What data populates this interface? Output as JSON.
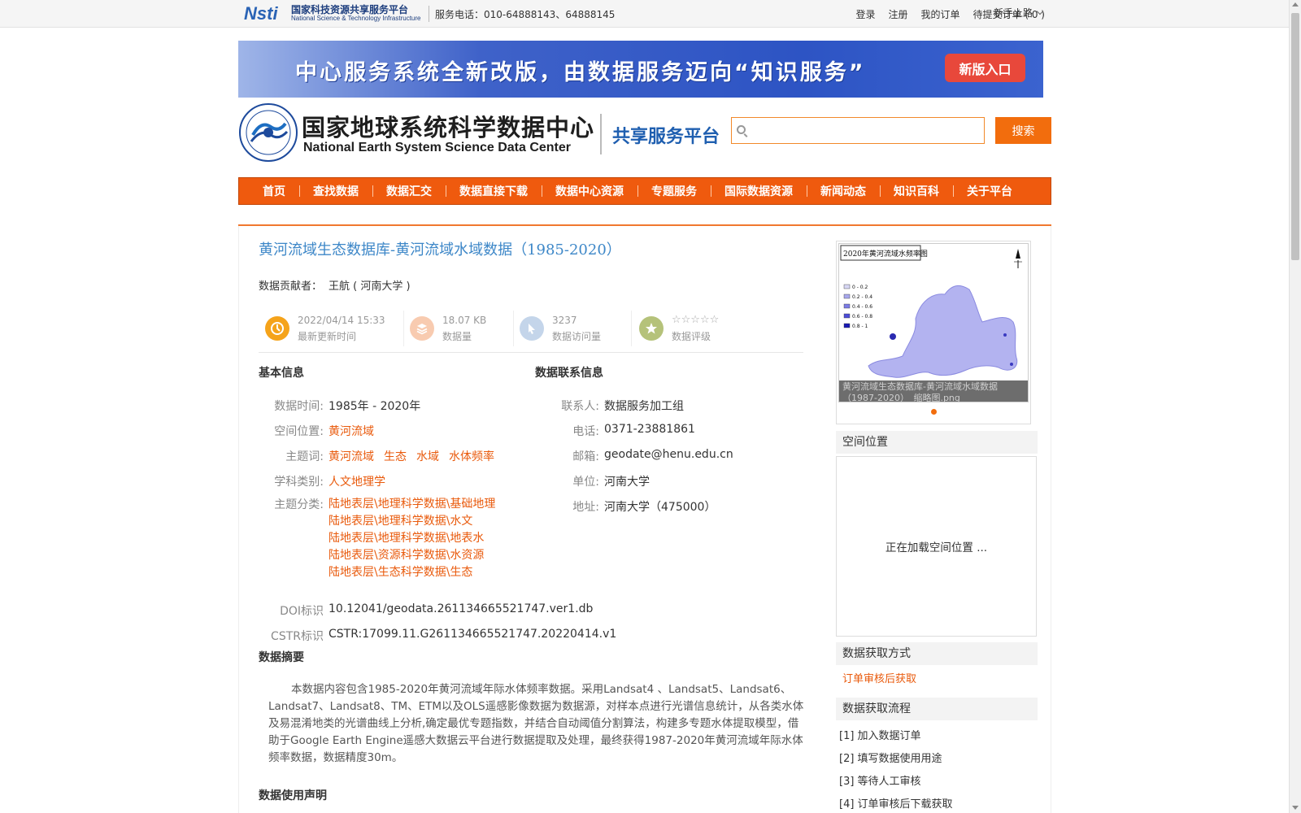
{
  "topbar": {
    "nsti_mark": "Nsti",
    "nsti_cn": "国家科技资源共享服务平台",
    "nsti_en": "National Science & Technology Infrastructure",
    "phone": "服务电话：010-64888143、64888145",
    "links": [
      "登录",
      "注册",
      "我的订单",
      "待提交订单 ( 0 )"
    ],
    "guide": "新手上路"
  },
  "banner": {
    "text": "中心服务系统全新改版，由数据服务迈向“知识服务”",
    "button": "新版入口"
  },
  "header": {
    "logo_cn": "国家地球系统科学数据中心",
    "logo_en": "National Earth System Science Data Center",
    "platform": "共享服务平台",
    "search_placeholder": "",
    "search_button": "搜索"
  },
  "nav": [
    "首页",
    "查找数据",
    "数据汇交",
    "数据直接下载",
    "数据中心资源",
    "专题服务",
    "国际数据资源",
    "新闻动态",
    "知识百科",
    "关于平台"
  ],
  "dataset": {
    "title": "黄河流域生态数据库-黄河流域水域数据（1985-2020）",
    "contributor_label": "数据贡献者：",
    "contributor": "王航 ( 河南大学 )",
    "stats": [
      {
        "value": "2022/04/14 15:33",
        "label": "最新更新时间",
        "icon": "clock-icon",
        "color": "#f5a31a"
      },
      {
        "value": "18.07 KB",
        "label": "数据量",
        "icon": "layers-icon",
        "color": "#f8cbb0"
      },
      {
        "value": "3237",
        "label": "数据访问量",
        "icon": "pointer-icon",
        "color": "#c4d5ea"
      },
      {
        "value": "☆☆☆☆☆",
        "label": "数据评级",
        "icon": "star-icon",
        "color": "#b5c27a"
      }
    ]
  },
  "basic": {
    "title": "基本信息",
    "time_label": "数据时间:",
    "time": "1985年 - 2020年",
    "space_label": "空间位置:",
    "space": "黄河流域",
    "keywords_label": "主题词:",
    "keywords": [
      "黄河流域",
      "生态",
      "水域",
      "水体频率"
    ],
    "discipline_label": "学科类别:",
    "discipline": "人文地理学",
    "category_label": "主题分类:",
    "categories": [
      "陆地表层\\地理科学数据\\基础地理",
      "陆地表层\\地理科学数据\\水文",
      "陆地表层\\地理科学数据\\地表水",
      "陆地表层\\资源科学数据\\水资源",
      "陆地表层\\生态科学数据\\生态"
    ],
    "doi_label": "DOI标识",
    "doi": "10.12041/geodata.261134665521747.ver1.db",
    "cstr_label": "CSTR标识",
    "cstr": "CSTR:17099.11.G261134665521747.20220414.v1"
  },
  "contact": {
    "title": "数据联系信息",
    "person_label": "联系人:",
    "person": "数据服务加工组",
    "phone_label": "电话:",
    "phone": "0371-23881861",
    "email_label": "邮箱:",
    "email": "geodate@henu.edu.cn",
    "unit_label": "单位:",
    "unit": "河南大学",
    "address_label": "地址:",
    "address": "河南大学（475000）"
  },
  "abstract": {
    "title": "数据摘要",
    "text": "本数据内容包含1985-2020年黄河流域年际水体频率数据。采用Landsat4 、Landsat5、Landsat6、Landsat7、Landsat8、TM、ETM以及OLS遥感影像数据为数据源，对样本点进行光谱信息统计，从各类水体及易混淆地类的光谱曲线上分析,确定最优专题指数，并结合自动阈值分割算法，构建多专题水体提取模型，借助于Google Earth Engine遥感大数据云平台进行数据提取及处理，最终获得1987-2020年黄河流域年际水体频率数据，数据精度30m。"
  },
  "usage": {
    "title": "数据使用声明"
  },
  "side": {
    "thumb_title": "2020年黄河流域水频率图",
    "thumb_legend": [
      "0 - 0.2",
      "0.2 - 0.4",
      "0.4 - 0.6",
      "0.6 - 0.8",
      "0.8 - 1"
    ],
    "thumb_legend_colors": [
      "#d8d8f5",
      "#a8a8ee",
      "#7c7ce6",
      "#4d4dd8",
      "#1a1ab5"
    ],
    "thumb_caption": "黄河流域生态数据库-黄河流域水域数据（1987-2020）_缩略图.png",
    "space_title": "空间位置",
    "map_loading": "正在加载空间位置 ...",
    "access_title": "数据获取方式",
    "access": "订单审核后获取",
    "flow_title": "数据获取流程",
    "flow": [
      "[1] 加入数据订单",
      "[2] 填写数据使用用途",
      "[3] 等待人工审核",
      "[4] 订单审核后下载获取"
    ]
  }
}
